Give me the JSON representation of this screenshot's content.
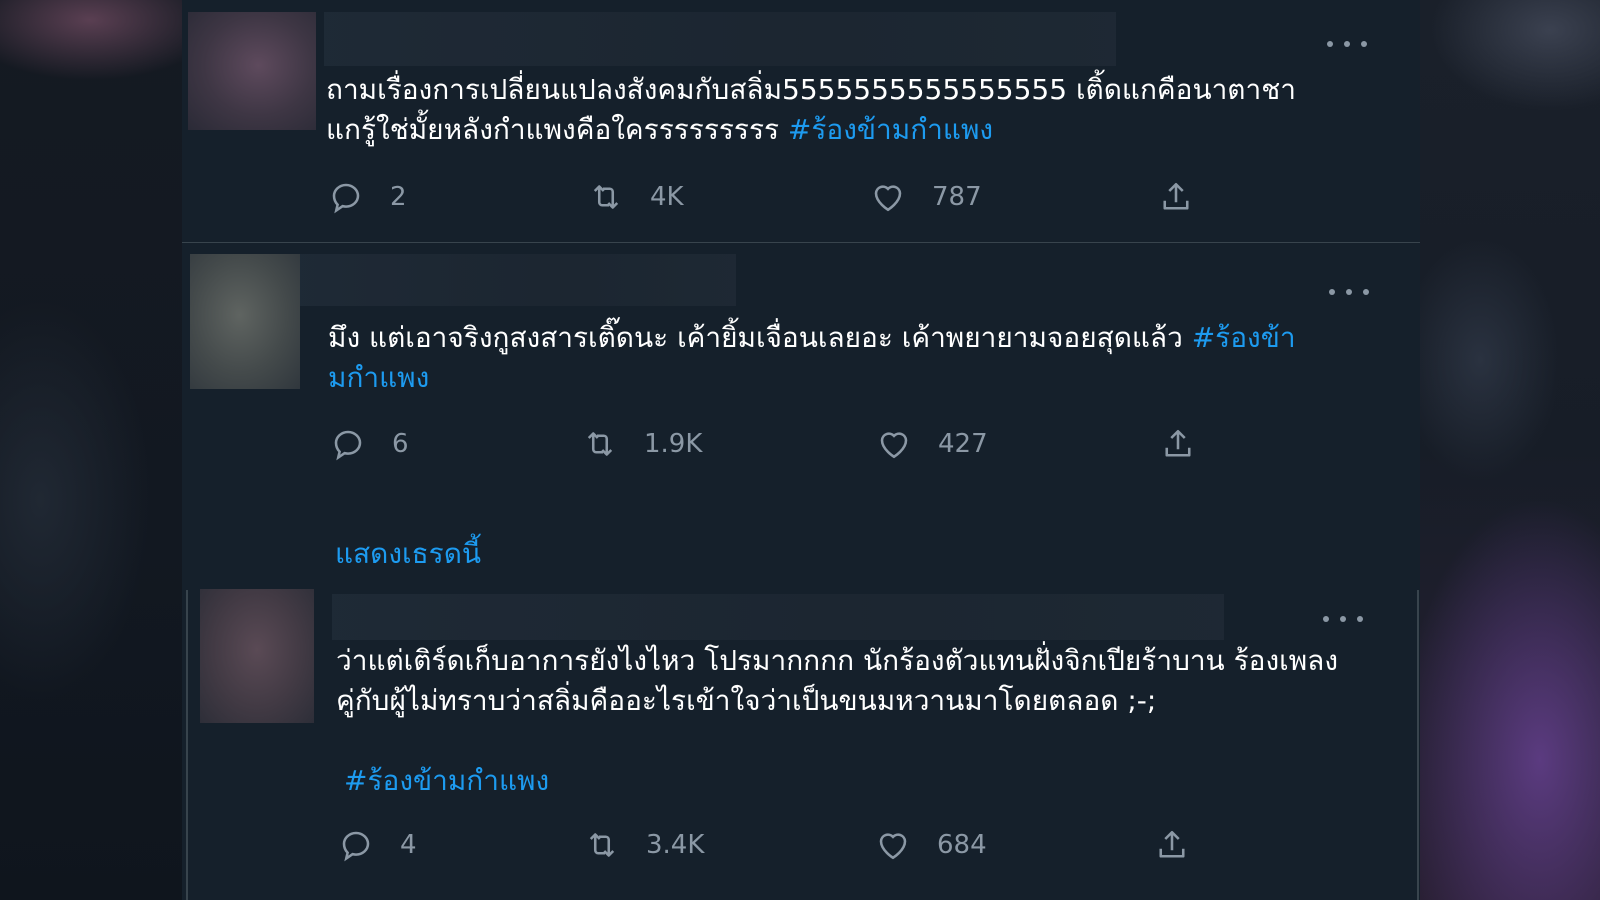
{
  "tweets": [
    {
      "line1": "ถามเรื่องการเปลี่ยนแปลงสังคมกับสลิ่ม5555555555555555 เติ้ดแกคือนาตาชา",
      "line2": "แกรู้ใช่มั้ยหลังกำแพงคือใครรรรรรรรร ",
      "hashtag": "#ร้องข้ามกำแพง",
      "replies": "2",
      "retweets": "4K",
      "likes": "787"
    },
    {
      "line1": "มึง แต่เอาจริงกูสงสารเติ๊ดนะ เค้ายิ้มเจื่อนเลยอะ เค้าพยายามจอยสุดแล้ว ",
      "hashtag_part1": "#ร้องข้า",
      "hashtag_part2": "มกำแพง",
      "replies": "6",
      "retweets": "1.9K",
      "likes": "427"
    },
    {
      "line1": "ว่าแต่เติร์ดเก็บอาการยังไงไหว โปรมากกกก นักร้องตัวแทนฝั่งจิกเปียร้าบาน ร้องเพลง",
      "line2": "คู่กับผู้ไม่ทราบว่าสลิ่มคืออะไรเข้าใจว่าเป็นขนมหวานมาโดยตลอด ;-;",
      "hashtag": "#ร้องข้ามกำแพง",
      "replies": "4",
      "retweets": "3.4K",
      "likes": "684"
    }
  ],
  "show_thread_label": "แสดงเธรดนี้",
  "icons": {
    "reply": "reply-icon",
    "retweet": "retweet-icon",
    "like": "heart-icon",
    "share": "share-icon",
    "more": "more-icon"
  },
  "colors": {
    "background": "#15202b",
    "text": "#ffffff",
    "secondary": "#8b98a5",
    "accent": "#1d9bf0",
    "divider": "#38444d"
  }
}
